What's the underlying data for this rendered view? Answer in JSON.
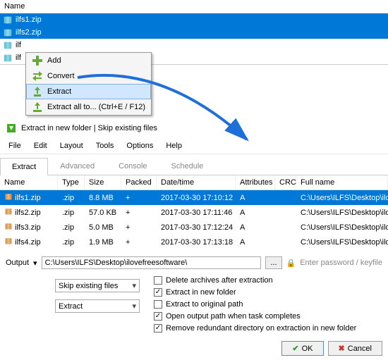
{
  "top": {
    "header": "Name",
    "items": [
      {
        "name": "ilfs1.zip",
        "sel": true
      },
      {
        "name": "ilfs2.zip",
        "sel": true
      },
      {
        "name": "ilf",
        "sel": false
      },
      {
        "name": "ilf",
        "sel": false
      }
    ]
  },
  "ctx": {
    "add": "Add",
    "convert": "Convert",
    "extract": "Extract",
    "extract_all": "Extract all to... (Ctrl+E / F12)"
  },
  "title": "Extract in new folder | Skip existing files",
  "menubar": [
    "File",
    "Edit",
    "Layout",
    "Tools",
    "Options",
    "Help"
  ],
  "tabs": {
    "extract": "Extract",
    "advanced": "Advanced",
    "console": "Console",
    "schedule": "Schedule"
  },
  "cols": {
    "name": "Name",
    "type": "Type",
    "size": "Size",
    "packed": "Packed",
    "dt": "Date/time",
    "attr": "Attributes",
    "crc": "CRC",
    "full": "Full name"
  },
  "rows": [
    {
      "name": "ilfs1.zip",
      "type": ".zip",
      "size": "8.8 MB",
      "packed": "+",
      "dt": "2017-03-30 17:10:12",
      "attr": "A",
      "full": "C:\\Users\\ILFS\\Desktop\\ilovefreesoftware\\",
      "sel": true
    },
    {
      "name": "ilfs2.zip",
      "type": ".zip",
      "size": "57.0 KB",
      "packed": "+",
      "dt": "2017-03-30 17:11:46",
      "attr": "A",
      "full": "C:\\Users\\ILFS\\Desktop\\ilovefreesoftware\\",
      "sel": false
    },
    {
      "name": "ilfs3.zip",
      "type": ".zip",
      "size": "5.0 MB",
      "packed": "+",
      "dt": "2017-03-30 17:12:24",
      "attr": "A",
      "full": "C:\\Users\\ILFS\\Desktop\\ilovefreesoftware\\",
      "sel": false
    },
    {
      "name": "ilfs4.zip",
      "type": ".zip",
      "size": "1.9 MB",
      "packed": "+",
      "dt": "2017-03-30 17:13:18",
      "attr": "A",
      "full": "C:\\Users\\ILFS\\Desktop\\ilovefreesoftware\\",
      "sel": false
    }
  ],
  "out": {
    "label": "Output",
    "path": "C:\\Users\\ILFS\\Desktop\\ilovefreesoftware\\",
    "browse": "...",
    "pw": "Enter password / keyfile"
  },
  "combos": {
    "skip": "Skip existing files",
    "mode": "Extract"
  },
  "checks": {
    "delete": "Delete archives after extraction",
    "newfolder": "Extract in new folder",
    "original": "Extract to original path",
    "openpath": "Open output path when task completes",
    "redundant": "Remove redundant directory on extraction in new folder"
  },
  "buttons": {
    "ok": "OK",
    "cancel": "Cancel"
  }
}
